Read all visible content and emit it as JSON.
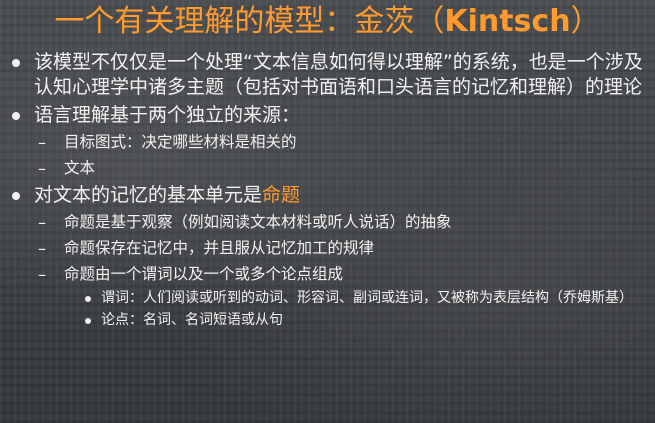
{
  "slide": {
    "title_cn": "一个有关理解的模型：金茨（",
    "title_latin": "Kintsch",
    "title_close": "）",
    "items": [
      {
        "text": "该模型不仅仅是一个处理“文本信息如何得以理解”的系统，也是一个涉及认知心理学中诸多主题（包括对书面语和口头语言的记忆和理解）的理论"
      },
      {
        "text": "语言理解基于两个独立的来源：",
        "children": [
          {
            "marker": "–",
            "text": "目标图式：决定哪些材料是相关的"
          },
          {
            "marker": "–",
            "text": "文本"
          }
        ]
      },
      {
        "text_before": "对文本的记忆的基本单元是",
        "highlight": "命题",
        "children": [
          {
            "marker": "–",
            "text": "命题是基于观察（例如阅读文本材料或听人说话）的抽象"
          },
          {
            "marker": "–",
            "text": "命题保存在记忆中，并且服从记忆加工的规律"
          },
          {
            "marker": "–",
            "text": "命题由一个谓词以及一个或多个论点组成",
            "children": [
              {
                "text": "谓词：人们阅读或听到的动词、形容词、副词或连词，又被称为表层结构（乔姆斯基）"
              },
              {
                "text": "论点：名词、名词短语或从句"
              }
            ]
          }
        ]
      }
    ]
  },
  "colors": {
    "accent": "#ff9a2e",
    "text": "#f2f2f2",
    "background": "#3f4246"
  }
}
